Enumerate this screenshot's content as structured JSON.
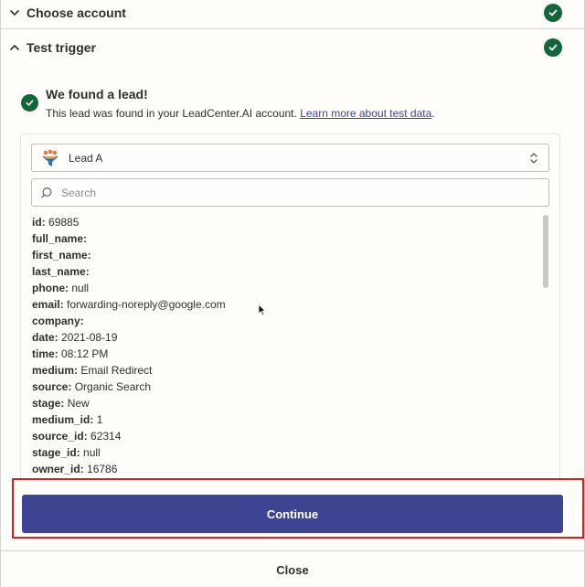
{
  "sections": {
    "choose_account": {
      "title": "Choose account",
      "state": "complete"
    },
    "test_trigger": {
      "title": "Test trigger",
      "state": "complete"
    }
  },
  "result": {
    "title": "We found a lead!",
    "description": "This lead was found in your LeadCenter.AI account.",
    "link": "Learn more about test data",
    "trailing": "."
  },
  "lead_select": {
    "selected": "Lead A",
    "icon": "leadcenter-logo-icon"
  },
  "search": {
    "placeholder": "Search",
    "value": ""
  },
  "fields": [
    {
      "key": "id:",
      "value": "69885"
    },
    {
      "key": "full_name:",
      "value": ""
    },
    {
      "key": "first_name:",
      "value": ""
    },
    {
      "key": "last_name:",
      "value": ""
    },
    {
      "key": "phone:",
      "value": "null"
    },
    {
      "key": "email:",
      "value": "forwarding-noreply@google.com"
    },
    {
      "key": "company:",
      "value": ""
    },
    {
      "key": "date:",
      "value": "2021-08-19"
    },
    {
      "key": "time:",
      "value": "08:12 PM"
    },
    {
      "key": "medium:",
      "value": "Email Redirect"
    },
    {
      "key": "source:",
      "value": "Organic Search"
    },
    {
      "key": "stage:",
      "value": "New"
    },
    {
      "key": "medium_id:",
      "value": "1"
    },
    {
      "key": "source_id:",
      "value": "62314"
    },
    {
      "key": "stage_id:",
      "value": "null"
    },
    {
      "key": "owner_id:",
      "value": "16786"
    }
  ],
  "actions": {
    "continue_label": "Continue",
    "close_label": "Close"
  },
  "colors": {
    "success": "#13663a",
    "primary": "#3d4592",
    "highlight": "#d41f1f",
    "background": "#fffdf9"
  }
}
